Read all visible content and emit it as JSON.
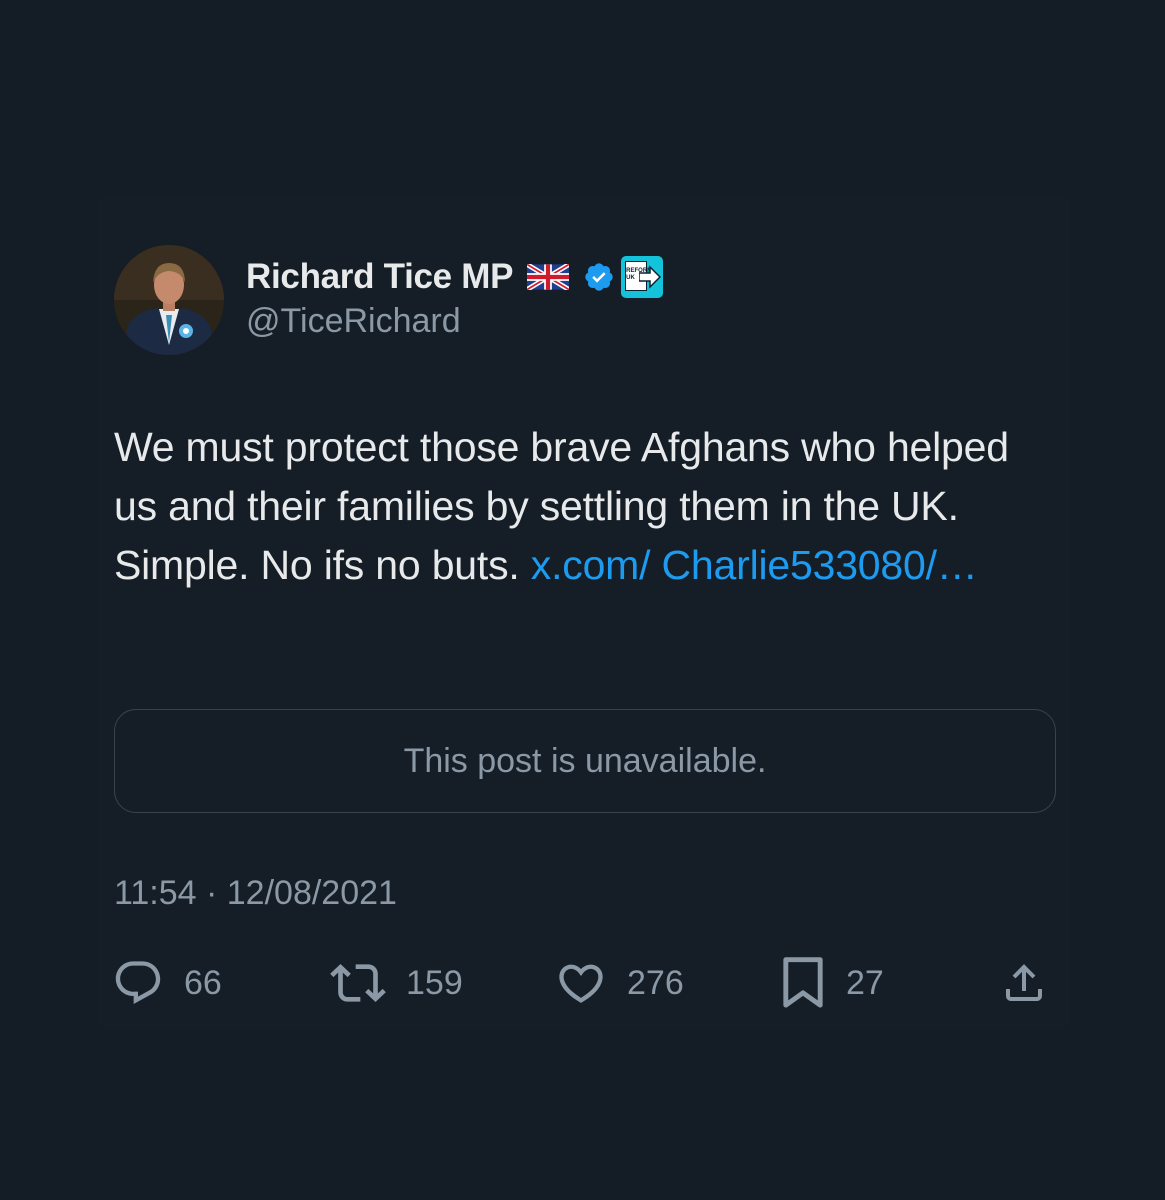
{
  "author": {
    "display_name": "Richard Tice MP",
    "handle": "@TiceRichard",
    "avatar_icon": "profile-photo",
    "flag_icon": "uk-flag-emoji",
    "verified_color": "#1d9bf0",
    "badge": {
      "icon": "reform-uk-logo",
      "text": "REFORM\nUK",
      "color": "#14c2d9"
    }
  },
  "tweet": {
    "text": "We must protect those brave Afghans who helped us and their families by settling them in the UK. Simple. No ifs no buts. ",
    "link_text": "x.com/ Charlie533080/…",
    "link_color": "#1d9bf0",
    "quoted_post_message": "This post is unavailable.",
    "timestamp": "11:54 · 12/08/2021"
  },
  "actions": {
    "replies": {
      "icon": "reply-icon",
      "count": "66"
    },
    "reposts": {
      "icon": "repost-icon",
      "count": "159"
    },
    "likes": {
      "icon": "heart-icon",
      "count": "276"
    },
    "bookmarks": {
      "icon": "bookmark-icon",
      "count": "27"
    },
    "share": {
      "icon": "share-icon"
    }
  },
  "colors": {
    "background": "#141d26",
    "text_primary": "#e7e9ea",
    "text_secondary": "#8b98a5",
    "border": "#38444d"
  }
}
